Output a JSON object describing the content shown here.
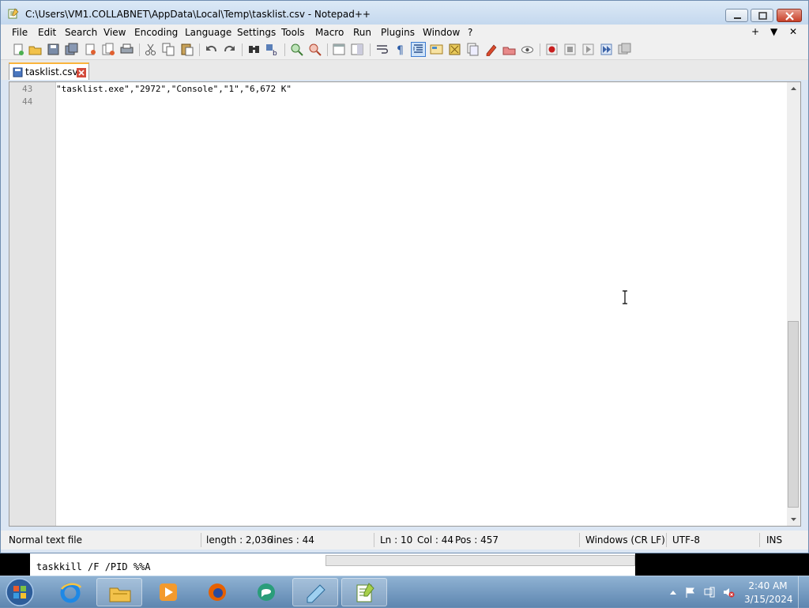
{
  "window": {
    "title": "C:\\Users\\VM1.COLLABNET\\AppData\\Local\\Temp\\tasklist.csv - Notepad++"
  },
  "menubar": {
    "items": [
      "File",
      "Edit",
      "Search",
      "View",
      "Encoding",
      "Language",
      "Settings",
      "Tools",
      "Macro",
      "Run",
      "Plugins",
      "Window",
      "?"
    ],
    "right": [
      "+",
      "▼",
      "✕"
    ]
  },
  "toolbar": {
    "icons": [
      "new-file-icon",
      "open-file-icon",
      "save-icon",
      "save-all-icon",
      "close-icon",
      "close-all-icon",
      "print-icon",
      "cut-icon",
      "copy-icon",
      "paste-icon",
      "undo-icon",
      "redo-icon",
      "find-icon",
      "replace-icon",
      "zoom-in-icon",
      "zoom-out-icon",
      "sync-vertical-icon",
      "sync-horizontal-icon",
      "word-wrap-icon",
      "show-all-chars-icon",
      "indent-guide-icon",
      "user-language-icon",
      "document-map-icon",
      "function-list-icon",
      "folder-as-workspace-icon",
      "monitoring-icon",
      "record-macro-icon",
      "stop-macro-icon",
      "play-macro-icon",
      "run-macro-multiple-icon",
      "save-macro-icon"
    ]
  },
  "tab": {
    "label": "tasklist.csv"
  },
  "editor": {
    "lines": [
      {
        "number": "43",
        "text": "\"tasklist.exe\",\"2972\",\"Console\",\"1\",\"6,672 K\""
      },
      {
        "number": "44",
        "text": ""
      }
    ]
  },
  "statusbar": {
    "file_type": "Normal text file",
    "length": "length : 2,036",
    "lines": "lines : 44",
    "ln": "Ln : 10",
    "col": "Col : 44",
    "pos": "Pos : 457",
    "eol": "Windows (CR LF)",
    "encoding": "UTF-8",
    "mode": "INS"
  },
  "console": {
    "text": "taskkill /F /PID %%A"
  },
  "taskbar": {
    "apps": [
      "internet-explorer-icon",
      "file-explorer-icon",
      "media-player-icon",
      "firefox-icon",
      "chat-app-icon",
      "notepad-icon",
      "notepadpp-icon"
    ],
    "clock_time": "2:40 AM",
    "clock_date": "3/15/2024"
  }
}
